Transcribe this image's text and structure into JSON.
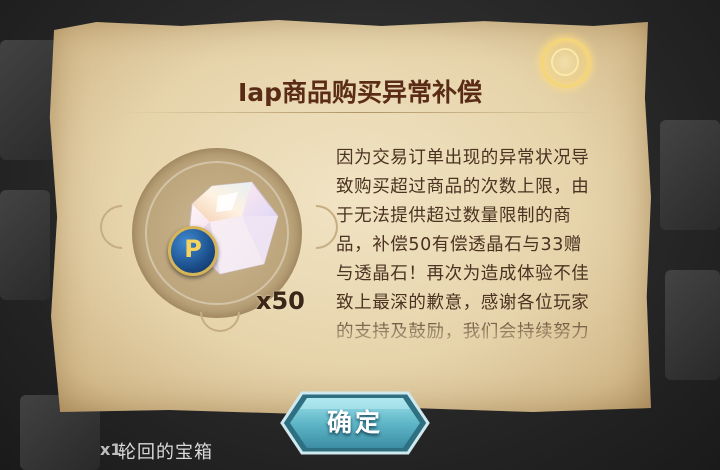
{
  "dialog": {
    "title": "Iap商品购买异常补偿",
    "description": "因为交易订单出现的异常状况导致购买超过商品的次数上限，由于无法提供超过数量限制的商品，补偿50有偿透晶石与33赠与透晶石！再次为造成体验不佳致上最深的歉意，感谢各位玩家的支持及鼓励，我们会持续努力创造更好的游戏",
    "reward": {
      "quantity": "x50",
      "badge_letter": "P",
      "icon": "crystal-icon"
    },
    "close_icon": "glowing-ring-icon",
    "confirm_label": "确定"
  },
  "background": {
    "item_count": "x1",
    "item_name": "轮回的宝箱"
  },
  "colors": {
    "parchment": "#e6d3aa",
    "title": "#5a2c16",
    "text": "#4b3221",
    "button": "#5fb7c8",
    "badge": "#1c4f8c"
  }
}
